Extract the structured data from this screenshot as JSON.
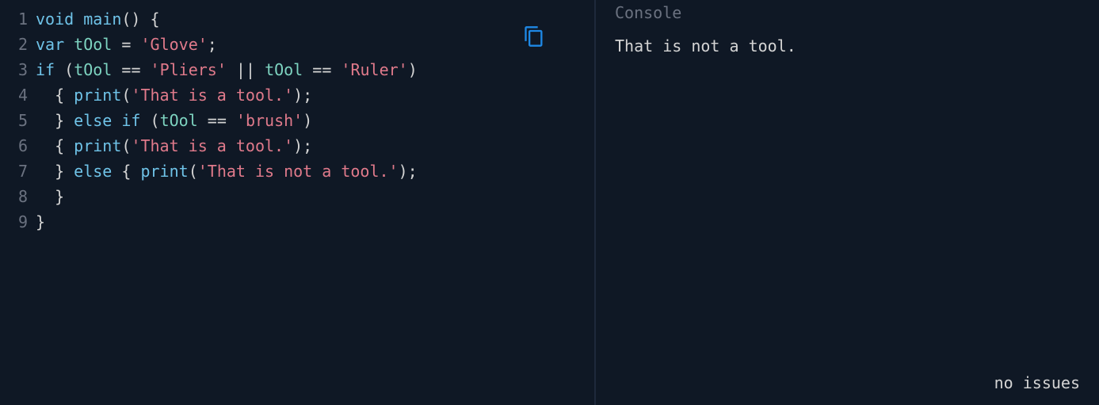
{
  "editor": {
    "line_numbers": [
      "1",
      "2",
      "3",
      "4",
      "5",
      "6",
      "7",
      "8",
      "9"
    ],
    "lines": [
      [
        {
          "t": "void",
          "c": "kw"
        },
        {
          "t": " ",
          "c": "pn"
        },
        {
          "t": "main",
          "c": "fn"
        },
        {
          "t": "() {",
          "c": "pn"
        }
      ],
      [
        {
          "t": "var",
          "c": "kw"
        },
        {
          "t": " ",
          "c": "pn"
        },
        {
          "t": "tOol",
          "c": "id"
        },
        {
          "t": " ",
          "c": "pn"
        },
        {
          "t": "=",
          "c": "op"
        },
        {
          "t": " ",
          "c": "pn"
        },
        {
          "t": "'Glove'",
          "c": "str"
        },
        {
          "t": ";",
          "c": "pn"
        }
      ],
      [
        {
          "t": "if",
          "c": "kw"
        },
        {
          "t": " (",
          "c": "pn"
        },
        {
          "t": "tOol",
          "c": "id"
        },
        {
          "t": " ",
          "c": "pn"
        },
        {
          "t": "==",
          "c": "op"
        },
        {
          "t": " ",
          "c": "pn"
        },
        {
          "t": "'Pliers'",
          "c": "str"
        },
        {
          "t": " ",
          "c": "pn"
        },
        {
          "t": "||",
          "c": "op"
        },
        {
          "t": " ",
          "c": "pn"
        },
        {
          "t": "tOol",
          "c": "id"
        },
        {
          "t": " ",
          "c": "pn"
        },
        {
          "t": "==",
          "c": "op"
        },
        {
          "t": " ",
          "c": "pn"
        },
        {
          "t": "'Ruler'",
          "c": "str"
        },
        {
          "t": ")",
          "c": "pn"
        }
      ],
      [
        {
          "t": "  { ",
          "c": "pn"
        },
        {
          "t": "print",
          "c": "fn"
        },
        {
          "t": "(",
          "c": "pn"
        },
        {
          "t": "'That is a tool.'",
          "c": "str"
        },
        {
          "t": ");",
          "c": "pn"
        }
      ],
      [
        {
          "t": "  } ",
          "c": "pn"
        },
        {
          "t": "else if",
          "c": "kw"
        },
        {
          "t": " (",
          "c": "pn"
        },
        {
          "t": "tOol",
          "c": "id"
        },
        {
          "t": " ",
          "c": "pn"
        },
        {
          "t": "==",
          "c": "op"
        },
        {
          "t": " ",
          "c": "pn"
        },
        {
          "t": "'brush'",
          "c": "str"
        },
        {
          "t": ")",
          "c": "pn"
        }
      ],
      [
        {
          "t": "  { ",
          "c": "pn"
        },
        {
          "t": "print",
          "c": "fn"
        },
        {
          "t": "(",
          "c": "pn"
        },
        {
          "t": "'That is a tool.'",
          "c": "str"
        },
        {
          "t": ");",
          "c": "pn"
        }
      ],
      [
        {
          "t": "  } ",
          "c": "pn"
        },
        {
          "t": "else",
          "c": "kw"
        },
        {
          "t": " { ",
          "c": "pn"
        },
        {
          "t": "print",
          "c": "fn"
        },
        {
          "t": "(",
          "c": "pn"
        },
        {
          "t": "'That is not a tool.'",
          "c": "str"
        },
        {
          "t": ");",
          "c": "pn"
        }
      ],
      [
        {
          "t": "  }",
          "c": "pn"
        }
      ],
      [
        {
          "t": "}",
          "c": "pn"
        }
      ]
    ]
  },
  "console": {
    "title": "Console",
    "output": "That is not a tool.",
    "issues": "no issues"
  }
}
